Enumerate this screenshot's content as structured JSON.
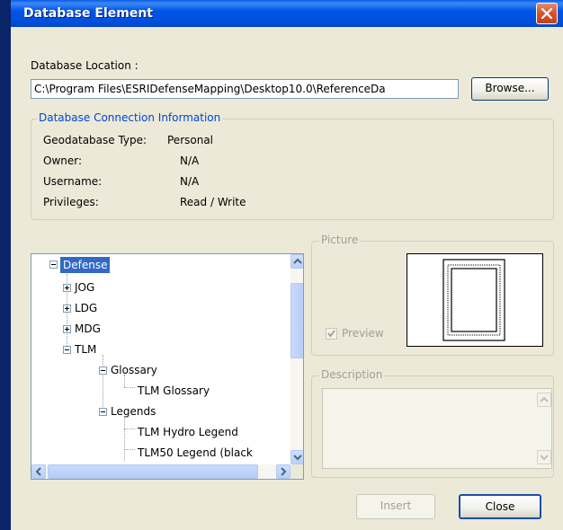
{
  "window": {
    "title": "Database Element"
  },
  "location": {
    "label": "Database Location :",
    "path": "C:\\Program Files\\ESRIDefenseMapping\\Desktop10.0\\ReferenceDa",
    "browse_label": "Browse..."
  },
  "connection": {
    "legend": "Database Connection Information",
    "rows": [
      {
        "label": "Geodatabase Type:",
        "value": "Personal"
      },
      {
        "label": "Owner:",
        "value": "N/A"
      },
      {
        "label": "Username:",
        "value": "N/A"
      },
      {
        "label": "Privileges:",
        "value": "Read / Write"
      }
    ]
  },
  "tree": {
    "nodes": [
      {
        "label": "Defense",
        "expander": "minus",
        "selected": true
      },
      {
        "label": "JOG",
        "expander": "plus"
      },
      {
        "label": "LDG",
        "expander": "plus"
      },
      {
        "label": "MDG",
        "expander": "plus"
      },
      {
        "label": "TLM",
        "expander": "minus"
      },
      {
        "label": "Glossary",
        "expander": "minus"
      },
      {
        "label": "TLM Glossary",
        "expander": "none"
      },
      {
        "label": "Legends",
        "expander": "minus"
      },
      {
        "label": "TLM Hydro Legend",
        "expander": "none"
      },
      {
        "label": "TLM50 Legend (black",
        "expander": "none"
      }
    ]
  },
  "picture": {
    "legend": "Picture",
    "preview_label": "Preview",
    "preview_checked": true
  },
  "description": {
    "legend": "Description"
  },
  "buttons": {
    "insert_label": "Insert",
    "close_label": "Close"
  },
  "colors": {
    "titlebar": "#0055e5",
    "selection": "#316ac5",
    "dialog_bg": "#ece9d8"
  }
}
